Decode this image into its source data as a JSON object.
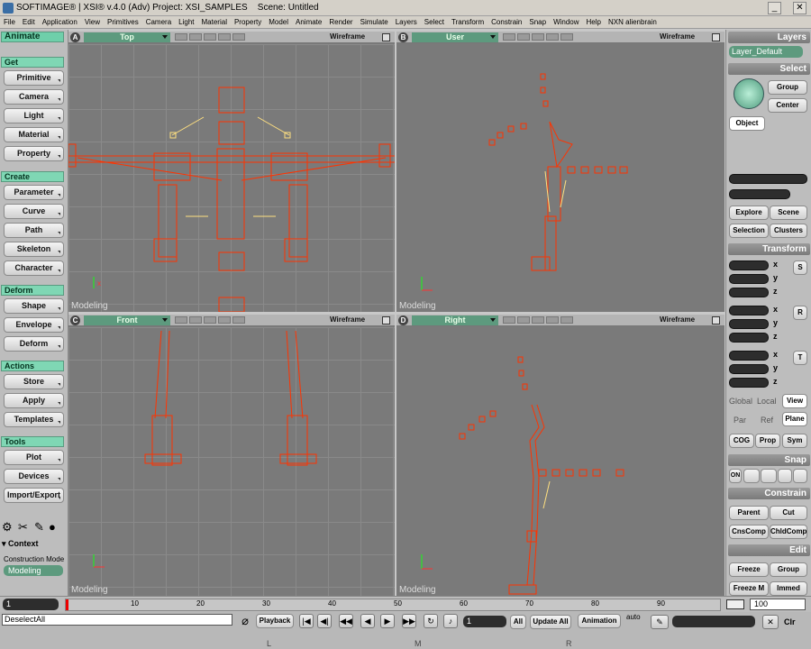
{
  "titlebar": {
    "title": "SOFTIMAGE® | XSI® v.4.0 (Adv) Project: XSI_SAMPLES    Scene: Untitled",
    "min": "_",
    "close": "✕"
  },
  "menu": [
    "File",
    "Edit",
    "Application",
    "View",
    "Primitives",
    "Camera",
    "Light",
    "Material",
    "Property",
    "Model",
    "Animate",
    "Render",
    "Simulate",
    "Layers",
    "Select",
    "Transform",
    "Constrain",
    "Snap",
    "Window",
    "Help",
    "NXN alienbrain"
  ],
  "left": {
    "mode": "Animate",
    "get": {
      "title": "Get",
      "items": [
        "Primitive",
        "Camera",
        "Light",
        "Material",
        "Property"
      ]
    },
    "create": {
      "title": "Create",
      "items": [
        "Parameter",
        "Curve",
        "Path",
        "Skeleton",
        "Character"
      ]
    },
    "deform": {
      "title": "Deform",
      "items": [
        "Shape",
        "Envelope",
        "Deform"
      ]
    },
    "actions": {
      "title": "Actions",
      "items": [
        "Store",
        "Apply",
        "Templates"
      ]
    },
    "tools": {
      "title": "Tools",
      "items": [
        "Plot",
        "Devices",
        "Import/Export"
      ]
    },
    "context": "▾ Context",
    "construction_label": "Construction Mode",
    "construction_value": "Modeling"
  },
  "viewports": [
    {
      "letter": "A",
      "name": "Top",
      "mode": "Wireframe",
      "footer": "Modeling"
    },
    {
      "letter": "B",
      "name": "User",
      "mode": "Wireframe",
      "footer": "Modeling"
    },
    {
      "letter": "C",
      "name": "Front",
      "mode": "Wireframe",
      "footer": "Modeling"
    },
    {
      "letter": "D",
      "name": "Right",
      "mode": "Wireframe",
      "footer": "Modeling"
    }
  ],
  "right": {
    "layers": "Layers",
    "layer_value": "Layer_Default",
    "select": "Select",
    "group": "Group",
    "center": "Center",
    "object": "Object",
    "explore": "Explore",
    "scene": "Scene",
    "selection": "Selection",
    "clusters": "Clusters",
    "transform": "Transform",
    "x": "x",
    "y": "y",
    "z": "z",
    "s": "S",
    "r": "R",
    "t": "T",
    "global": "Global",
    "local": "Local",
    "view": "View",
    "par": "Par",
    "ref": "Ref",
    "plane": "Plane",
    "cog": "COG",
    "prop": "Prop",
    "sym": "Sym",
    "snap": "Snap",
    "on": "ON",
    "constrain": "Constrain",
    "parent": "Parent",
    "cut": "Cut",
    "cnscomp": "CnsComp",
    "chldcomp": "ChldComp",
    "edit": "Edit",
    "freeze": "Freeze",
    "egroup": "Group",
    "freezem": "Freeze M",
    "immed": "Immed"
  },
  "timeline": {
    "start": "1",
    "end": "100",
    "ticks": [
      "10",
      "20",
      "30",
      "40",
      "50",
      "60",
      "70",
      "80",
      "90"
    ]
  },
  "bottom": {
    "command": "DeselectAll",
    "playback": "Playback",
    "frame": "1",
    "all": "All",
    "update_all": "Update All",
    "animation": "Animation",
    "auto": "auto",
    "clr": "Clr",
    "markers": [
      "L",
      "M",
      "R"
    ]
  }
}
